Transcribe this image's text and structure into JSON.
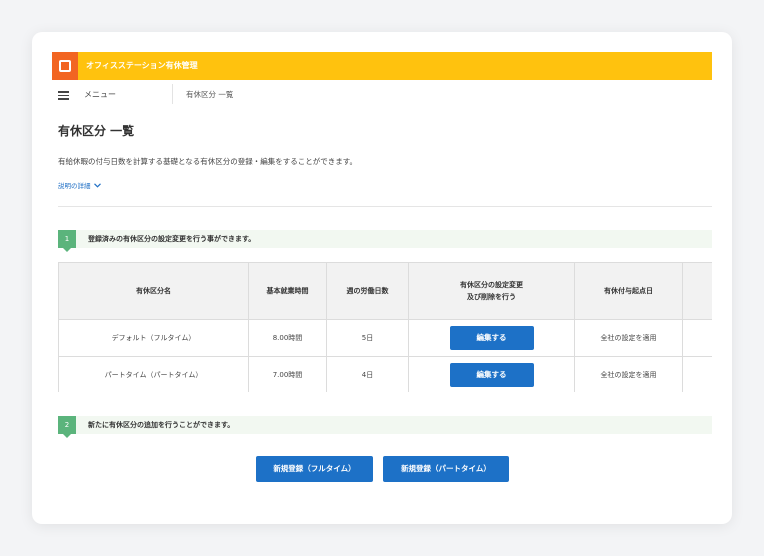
{
  "header": {
    "app_title": "オフィスステーション有休管理"
  },
  "nav": {
    "menu_label": "メニュー",
    "breadcrumb": "有休区分 一覧"
  },
  "page": {
    "title": "有休区分 一覧",
    "description": "有給休暇の付与日数を計算する基礎となる有休区分の登録・編集をすることができます。",
    "details_link": "説明の詳細"
  },
  "step1": {
    "number": "1",
    "text": "登録済みの有休区分の設定変更を行う事ができます。"
  },
  "table": {
    "headers": [
      "有休区分名",
      "基本就業時間",
      "週の労働日数",
      "有休区分の設定変更",
      "及び削除を行う",
      "有休付与起点日"
    ],
    "rows": [
      {
        "name": "デフォルト（フルタイム）",
        "hours": "8.00時間",
        "days": "5日",
        "action": "編集する",
        "origin": "全社の設定を適用"
      },
      {
        "name": "パートタイム（パートタイム）",
        "hours": "7.00時間",
        "days": "4日",
        "action": "編集する",
        "origin": "全社の設定を適用"
      }
    ]
  },
  "step2": {
    "number": "2",
    "text": "新たに有休区分の追加を行うことができます。"
  },
  "buttons": {
    "register_full": "新規登録（フルタイム）",
    "register_part": "新規登録（パートタイム）"
  },
  "colors": {
    "header": "#ffc20e",
    "logo": "#f26522",
    "step_badge": "#5bb47c",
    "primary": "#1d71c7",
    "link": "#1f6fc5"
  }
}
